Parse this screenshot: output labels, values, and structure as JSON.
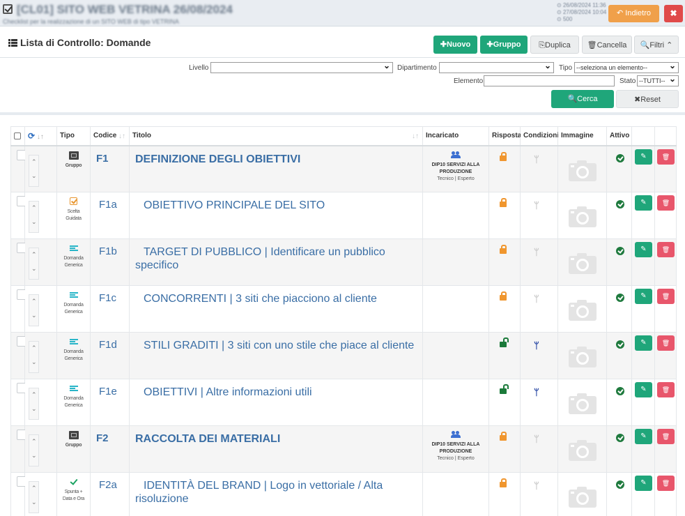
{
  "header": {
    "title": "[CL01] SITO WEB VETRINA 26/08/2024",
    "subtitle": "Checklist per la realizzazione di un SITO WEB di tipo VETRINA",
    "meta": [
      "26/08/2024 11:36",
      "27/08/2024 10:04",
      "500"
    ],
    "back_label": "Indietro",
    "close_label": "✖"
  },
  "section": {
    "title": "Lista di Controllo: Domande"
  },
  "toolbar": {
    "nuovo": "✚Nuovo",
    "gruppo": "✚Gruppo",
    "duplica": "⎘Duplica",
    "cancella": "🗑Cancella",
    "filtri": "🔍Filtri ⌃"
  },
  "filters": {
    "livello_label": "Livello",
    "livello_value": "",
    "dipartimento_label": "Dipartimento",
    "dipartimento_value": "",
    "tipo_label": "Tipo",
    "tipo_value": "--seleziona un elemento--",
    "elemento_label": "Elemento",
    "elemento_value": "",
    "stato_label": "Stato",
    "stato_value": "--TUTTI--",
    "cerca_label": "🔍Cerca",
    "reset_label": "✖Reset"
  },
  "table": {
    "columns": {
      "tipo": "Tipo",
      "codice": "Codice",
      "titolo": "Titolo",
      "incaricato": "Incaricato",
      "risposta": "Risposta",
      "condizioni": "Condizioni",
      "immagine": "Immagine",
      "attivo": "Attivo"
    },
    "rows": [
      {
        "tipo": "Gruppo",
        "codice": "F1",
        "titolo": "DEFINIZIONE DEGLI OBIETTIVI",
        "incaricato_dept": "DIP10 SERVIZI ALLA PRODUZIONE",
        "incaricato_role": "Tecnico | Esperto"
      },
      {
        "tipo": "Scelta Guidata",
        "codice": "F1a",
        "titolo": "OBIETTIVO PRINCIPALE DEL SITO",
        "incaricato_dept": "",
        "incaricato_role": ""
      },
      {
        "tipo": "Domanda Generica",
        "codice": "F1b",
        "titolo": "TARGET DI PUBBLICO | Identificare un pubblico specifico",
        "incaricato_dept": "",
        "incaricato_role": ""
      },
      {
        "tipo": "Domanda Generica",
        "codice": "F1c",
        "titolo": "CONCORRENTI | 3 siti che piacciono al cliente",
        "incaricato_dept": "",
        "incaricato_role": ""
      },
      {
        "tipo": "Domanda Generica",
        "codice": "F1d",
        "titolo": "STILI GRADITI | 3 siti con uno stile che piace al cliente",
        "incaricato_dept": "",
        "incaricato_role": ""
      },
      {
        "tipo": "Domanda Generica",
        "codice": "F1e",
        "titolo": "OBIETTIVI | Altre informazioni utili",
        "incaricato_dept": "",
        "incaricato_role": ""
      },
      {
        "tipo": "Gruppo",
        "codice": "F2",
        "titolo": "RACCOLTA DEI MATERIALI",
        "incaricato_dept": "DIP10 SERVIZI ALLA PRODUZIONE",
        "incaricato_role": "Tecnico | Esperto"
      },
      {
        "tipo": "Spunta + Data e Ora",
        "codice": "F2a",
        "titolo": "IDENTITÀ DEL BRAND | Logo in vettoriale / Alta risoluzione",
        "incaricato_dept": "",
        "incaricato_role": ""
      }
    ]
  },
  "colors": {
    "green": "#1fa67a",
    "orange": "#f0a04a",
    "red": "#e04a4a",
    "link_blue": "#3a6ea5"
  }
}
